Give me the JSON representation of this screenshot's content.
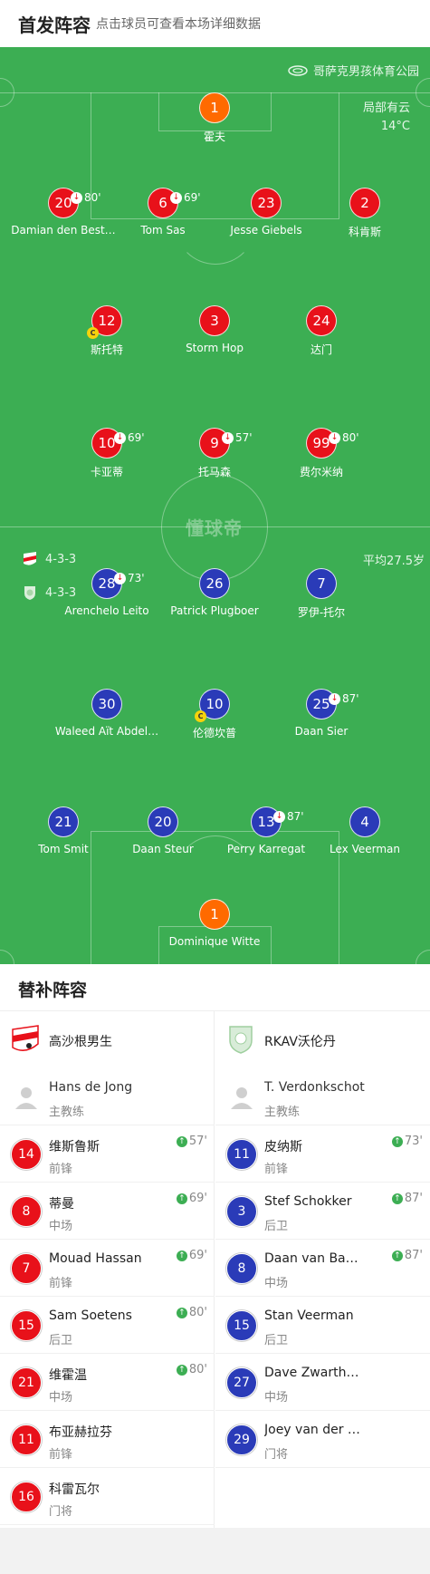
{
  "header": {
    "title": "首发阵容",
    "hint": "点击球员可查看本场详细数据"
  },
  "pitch": {
    "stadium": "哥萨克男孩体育公园",
    "weather": "局部有云",
    "temperature": "14°C",
    "watermark": "懂球帝",
    "avg_age": "平均27.5岁",
    "home_formation": "4-3-3",
    "away_formation": "4-3-3"
  },
  "home_players": [
    {
      "num": "1",
      "name": "霍夫",
      "gk": true,
      "sub": "",
      "captain": false
    },
    {
      "num": "20",
      "name": "Damian den Best…",
      "gk": false,
      "sub": "80'",
      "captain": false
    },
    {
      "num": "6",
      "name": "Tom Sas",
      "gk": false,
      "sub": "69'",
      "captain": false
    },
    {
      "num": "23",
      "name": "Jesse Giebels",
      "gk": false,
      "sub": "",
      "captain": false
    },
    {
      "num": "2",
      "name": "科肯斯",
      "gk": false,
      "sub": "",
      "captain": false
    },
    {
      "num": "12",
      "name": "斯托特",
      "gk": false,
      "sub": "",
      "captain": true
    },
    {
      "num": "3",
      "name": "Storm Hop",
      "gk": false,
      "sub": "",
      "captain": false
    },
    {
      "num": "24",
      "name": "达门",
      "gk": false,
      "sub": "",
      "captain": false
    },
    {
      "num": "10",
      "name": "卡亚蒂",
      "gk": false,
      "sub": "69'",
      "captain": false
    },
    {
      "num": "9",
      "name": "托马森",
      "gk": false,
      "sub": "57'",
      "captain": false
    },
    {
      "num": "99",
      "name": "费尔米纳",
      "gk": false,
      "sub": "80'",
      "captain": false
    }
  ],
  "away_players": [
    {
      "num": "28",
      "name": "Arenchelo Leito",
      "gk": false,
      "sub": "73'",
      "captain": false
    },
    {
      "num": "26",
      "name": "Patrick Plugboer",
      "gk": false,
      "sub": "",
      "captain": false
    },
    {
      "num": "7",
      "name": "罗伊-托尔",
      "gk": false,
      "sub": "",
      "captain": false
    },
    {
      "num": "30",
      "name": "Waleed Aït Abdel…",
      "gk": false,
      "sub": "",
      "captain": false
    },
    {
      "num": "10",
      "name": "伦德坎普",
      "gk": false,
      "sub": "",
      "captain": true
    },
    {
      "num": "25",
      "name": "Daan Sier",
      "gk": false,
      "sub": "87'",
      "captain": false
    },
    {
      "num": "21",
      "name": "Tom Smit",
      "gk": false,
      "sub": "",
      "captain": false
    },
    {
      "num": "20",
      "name": "Daan Steur",
      "gk": false,
      "sub": "",
      "captain": false
    },
    {
      "num": "13",
      "name": "Perry Karregat",
      "gk": false,
      "sub": "87'",
      "captain": false
    },
    {
      "num": "4",
      "name": "Lex Veerman",
      "gk": false,
      "sub": "",
      "captain": false
    },
    {
      "num": "1",
      "name": "Dominique Witte",
      "gk": true,
      "sub": "",
      "captain": false
    }
  ],
  "subs": {
    "title": "替补阵容",
    "home": {
      "team": "高沙根男生",
      "coach": "Hans de Jong",
      "coach_role": "主教练",
      "players": [
        {
          "num": "14",
          "name": "维斯鲁斯",
          "pos": "前锋",
          "time": "57'"
        },
        {
          "num": "8",
          "name": "蒂曼",
          "pos": "中场",
          "time": "69'"
        },
        {
          "num": "7",
          "name": "Mouad Hassan",
          "pos": "前锋",
          "time": "69'"
        },
        {
          "num": "15",
          "name": "Sam Soetens",
          "pos": "后卫",
          "time": "80'"
        },
        {
          "num": "21",
          "name": "维霍温",
          "pos": "中场",
          "time": "80'"
        },
        {
          "num": "11",
          "name": "布亚赫拉芬",
          "pos": "前锋",
          "time": ""
        },
        {
          "num": "16",
          "name": "科雷瓦尔",
          "pos": "门将",
          "time": ""
        }
      ]
    },
    "away": {
      "team": "RKAV沃伦丹",
      "coach": "T. Verdonkschot",
      "coach_role": "主教练",
      "players": [
        {
          "num": "11",
          "name": "皮纳斯",
          "pos": "前锋",
          "time": "73'"
        },
        {
          "num": "3",
          "name": "Stef Schokker",
          "pos": "后卫",
          "time": "87'"
        },
        {
          "num": "8",
          "name": "Daan van Ba…",
          "pos": "中场",
          "time": "87'"
        },
        {
          "num": "15",
          "name": "Stan Veerman",
          "pos": "后卫",
          "time": ""
        },
        {
          "num": "27",
          "name": "Dave Zwarth…",
          "pos": "中场",
          "time": ""
        },
        {
          "num": "29",
          "name": "Joey van der …",
          "pos": "门将",
          "time": ""
        }
      ]
    }
  },
  "colors": {
    "pitch": "#3cae53",
    "home": "#e8111a",
    "away": "#2a3bb8",
    "goalkeeper": "#ff6a00",
    "captain": "#f5d20c"
  }
}
